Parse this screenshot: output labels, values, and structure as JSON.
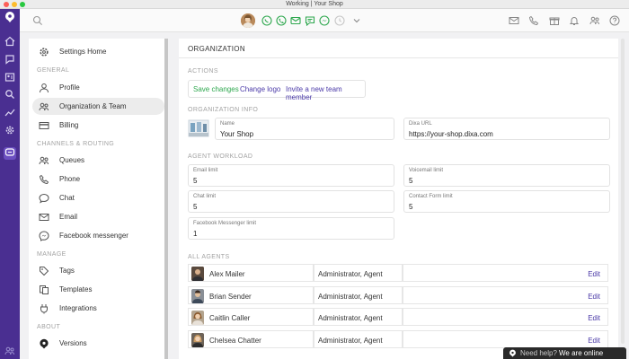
{
  "window": {
    "title": "Working | Your Shop"
  },
  "topbar": {
    "status_icons": [
      "whatsapp-icon",
      "phone-icon",
      "mail-icon",
      "chat-icon",
      "messenger-icon",
      "clock-icon"
    ]
  },
  "sidebar": {
    "home_label": "Settings Home",
    "sections": {
      "general": "GENERAL",
      "channels": "CHANNELS & ROUTING",
      "manage": "MANAGE",
      "about": "ABOUT"
    },
    "items": {
      "profile": "Profile",
      "organization": "Organization & Team",
      "billing": "Billing",
      "queues": "Queues",
      "phone": "Phone",
      "chat": "Chat",
      "email": "Email",
      "facebook": "Facebook messenger",
      "tags": "Tags",
      "templates": "Templates",
      "integrations": "Integrations",
      "versions": "Versions"
    }
  },
  "main": {
    "title": "ORGANIZATION",
    "actions_head": "ACTIONS",
    "actions": {
      "save": "Save changes",
      "logo": "Change logo",
      "invite": "Invite a new team member"
    },
    "info_head": "ORGANIZATION INFO",
    "name": {
      "label": "Name",
      "value": "Your Shop"
    },
    "url": {
      "label": "Dixa URL",
      "value": "https://your-shop.dixa.com"
    },
    "workload_head": "AGENT WORKLOAD",
    "limits": {
      "email": {
        "label": "Email limit",
        "value": "5"
      },
      "voicemail": {
        "label": "Voicemail limit",
        "value": "5"
      },
      "chat": {
        "label": "Chat limit",
        "value": "5"
      },
      "contact": {
        "label": "Contact Form limit",
        "value": "5"
      },
      "facebook": {
        "label": "Facebook Messenger limit",
        "value": "1"
      }
    },
    "agents_head": "ALL AGENTS",
    "agents": [
      {
        "name": "Alex Mailer",
        "role": "Administrator, Agent",
        "edit": "Edit"
      },
      {
        "name": "Brian Sender",
        "role": "Administrator, Agent",
        "edit": "Edit"
      },
      {
        "name": "Caitlin Caller",
        "role": "Administrator, Agent",
        "edit": "Edit"
      },
      {
        "name": "Chelsea Chatter",
        "role": "Administrator, Agent",
        "edit": "Edit"
      }
    ]
  },
  "help": {
    "prefix": "Need help?",
    "status": "We are online"
  },
  "colors": {
    "brand": "#4a2f91",
    "accent": "#4b3aa8",
    "green": "#2fa84f"
  }
}
